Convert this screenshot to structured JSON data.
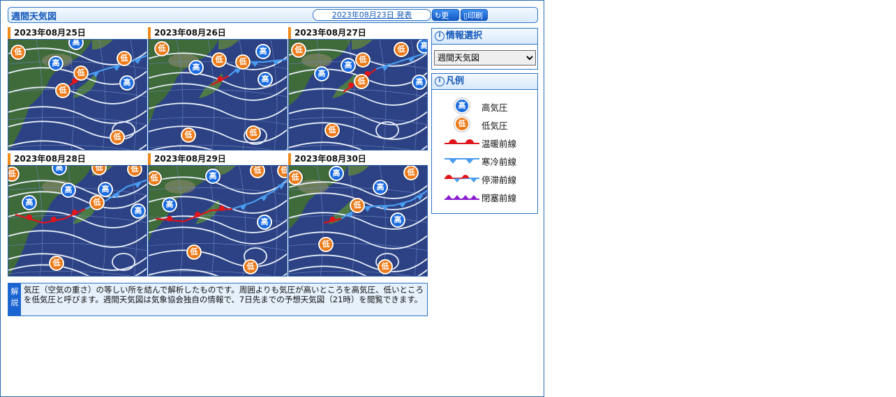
{
  "header": {
    "title": "週間天気図",
    "published": "2023年08月23日 発表",
    "refresh_label": "更新",
    "print_label": "印刷"
  },
  "maps": [
    {
      "date": "2023年08月25日"
    },
    {
      "date": "2023年08月26日"
    },
    {
      "date": "2023年08月27日"
    },
    {
      "date": "2023年08月28日"
    },
    {
      "date": "2023年08月29日"
    },
    {
      "date": "2023年08月30日"
    }
  ],
  "pressure_labels": {
    "high": "高",
    "low": "低"
  },
  "explanation": {
    "tag": "解説",
    "text": "気圧（空気の重さ）の等しい所を結んで解析したものです。周囲よりも気圧が高いところを高気圧、低いところを低気圧と呼びます。週間天気図は気象協会独自の情報で、7日先までの予想天気図（21時）を閲覧できます。"
  },
  "info_panel": {
    "title": "情報選択",
    "selected": "週間天気図"
  },
  "legend": {
    "title": "凡例",
    "items": [
      {
        "label": "高気圧",
        "icon": "high-pressure-icon"
      },
      {
        "label": "低気圧",
        "icon": "low-pressure-icon"
      },
      {
        "label": "温暖前線",
        "icon": "warm-front-icon"
      },
      {
        "label": "寒冷前線",
        "icon": "cold-front-icon"
      },
      {
        "label": "停滞前線",
        "icon": "stationary-front-icon"
      },
      {
        "label": "閉塞前線",
        "icon": "occluded-front-icon"
      }
    ]
  },
  "colors": {
    "high": "#1a6be0",
    "low": "#ec7a18",
    "warm_front": "#e0151b",
    "cold_front": "#4a9cf0",
    "occluded_front": "#8a1bd0",
    "ocean": "#2c4285",
    "accent": "#1458b8"
  }
}
